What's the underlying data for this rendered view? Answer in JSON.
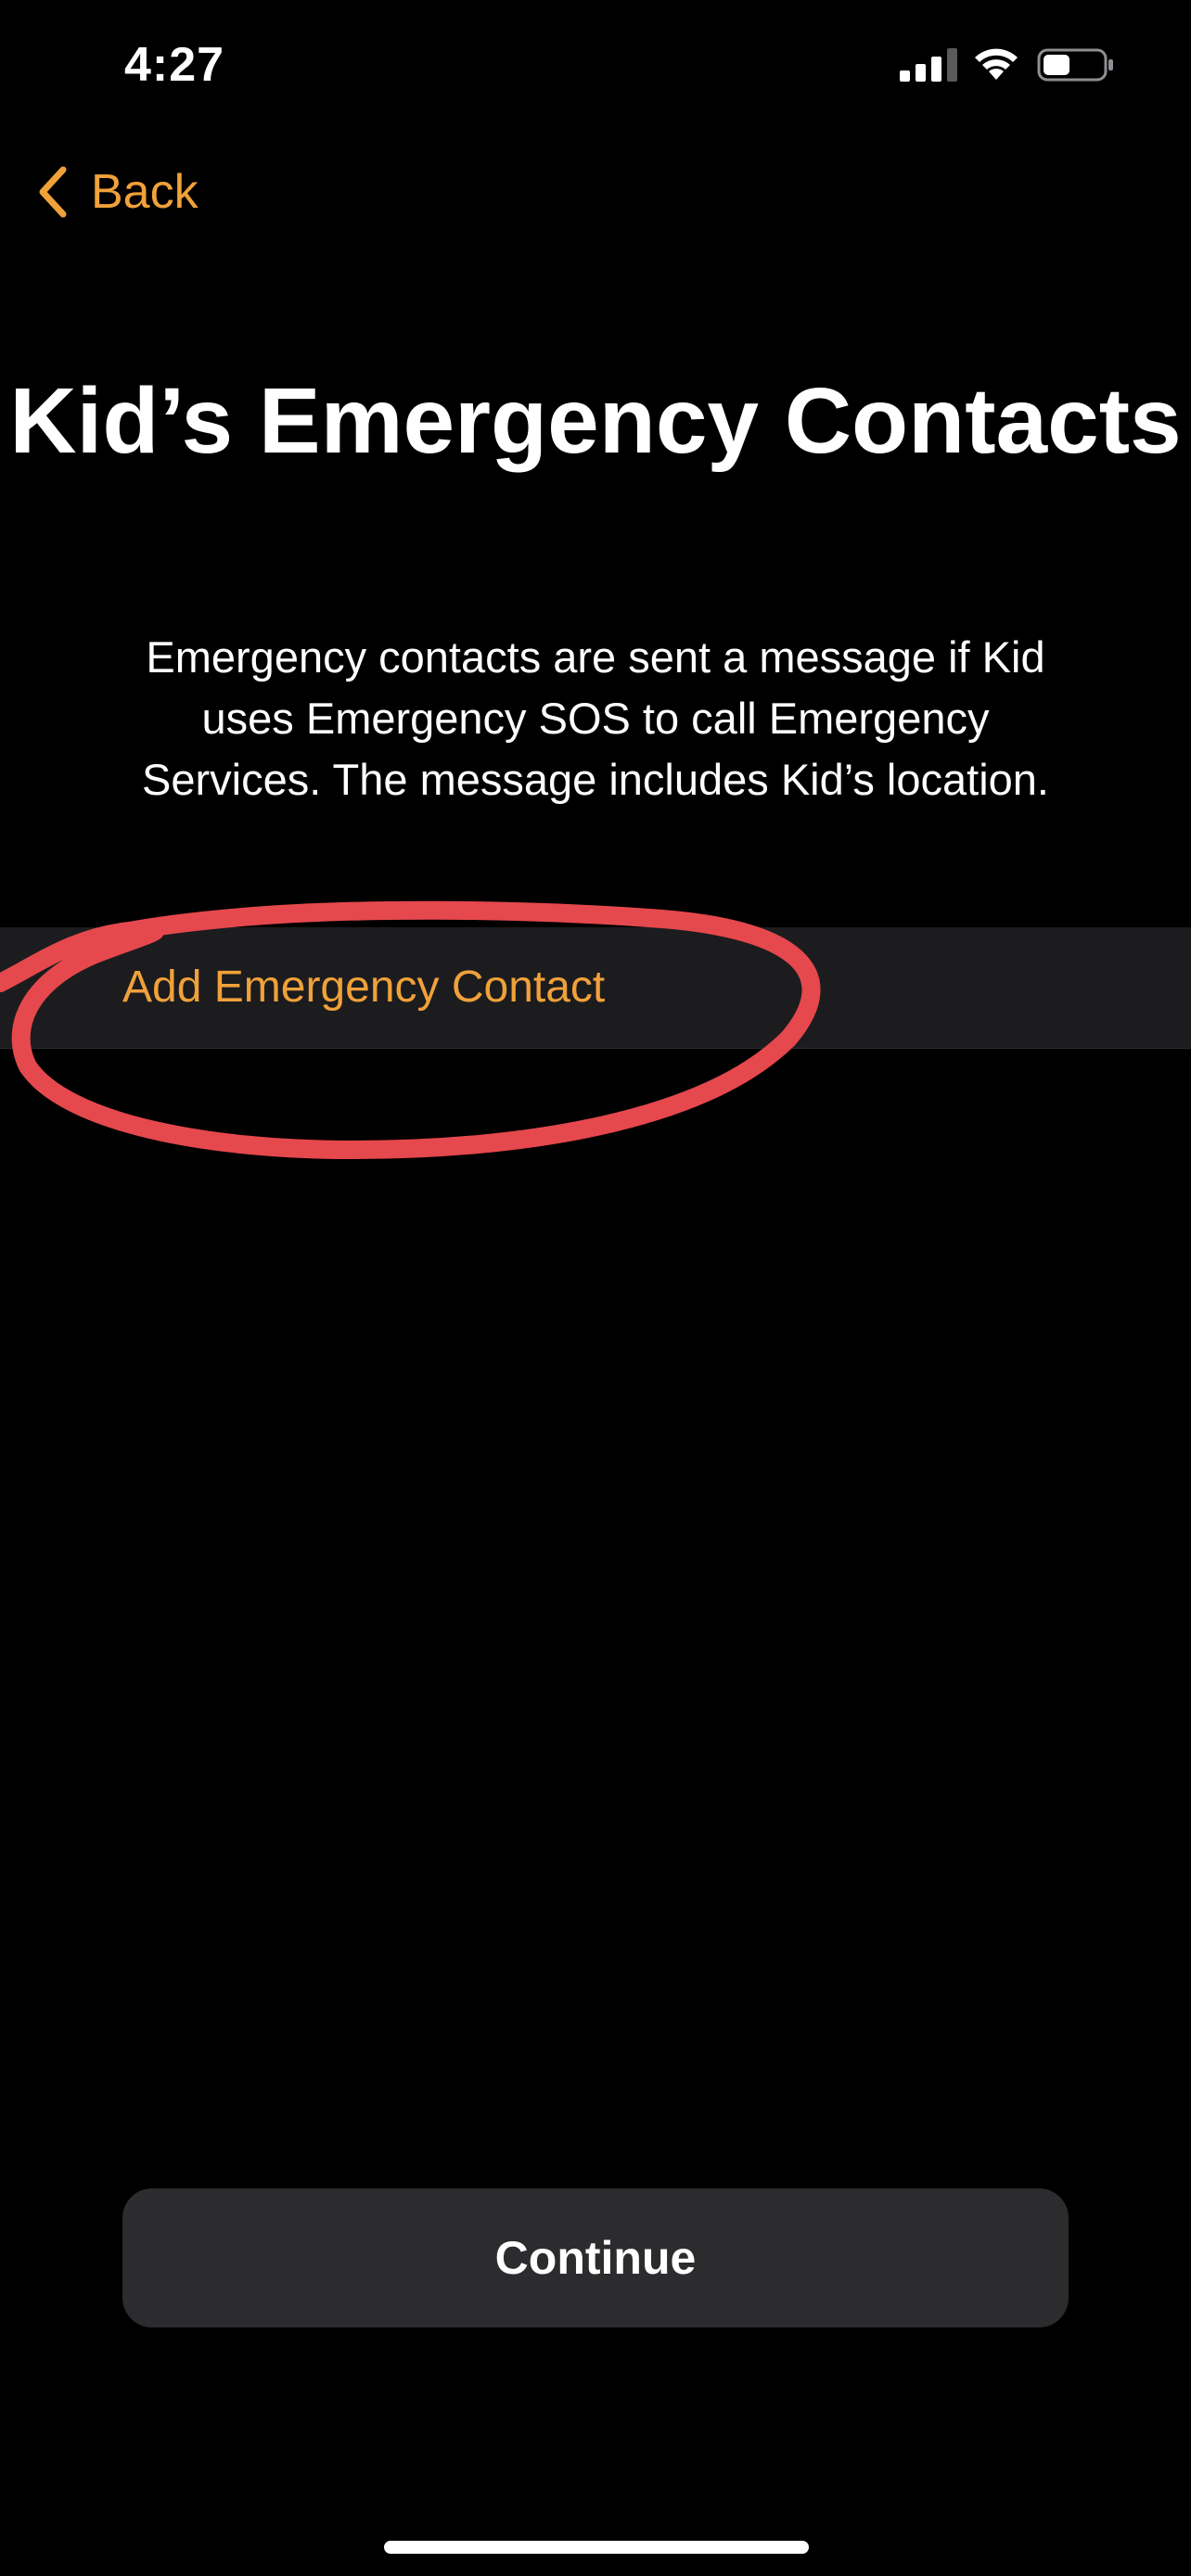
{
  "status_bar": {
    "time": "4:27",
    "signal_icon": "cellular-signal-icon",
    "wifi_icon": "wifi-icon",
    "battery_icon": "battery-icon"
  },
  "nav": {
    "back_label": "Back",
    "back_icon": "chevron-left-icon"
  },
  "page": {
    "title": "Kid’s Emergency Contacts",
    "description": "Emergency contacts are sent a message if Kid uses Emergency SOS to call Emergency Services. The message includes Kid’s location."
  },
  "contacts": {
    "add_label": "Add Emergency Contact"
  },
  "footer": {
    "continue_label": "Continue"
  },
  "colors": {
    "background": "#000000",
    "accent": "#F0A13A",
    "row_background": "#1C1C1E",
    "button_background": "#2C2C2E",
    "annotation": "#E5484D"
  }
}
